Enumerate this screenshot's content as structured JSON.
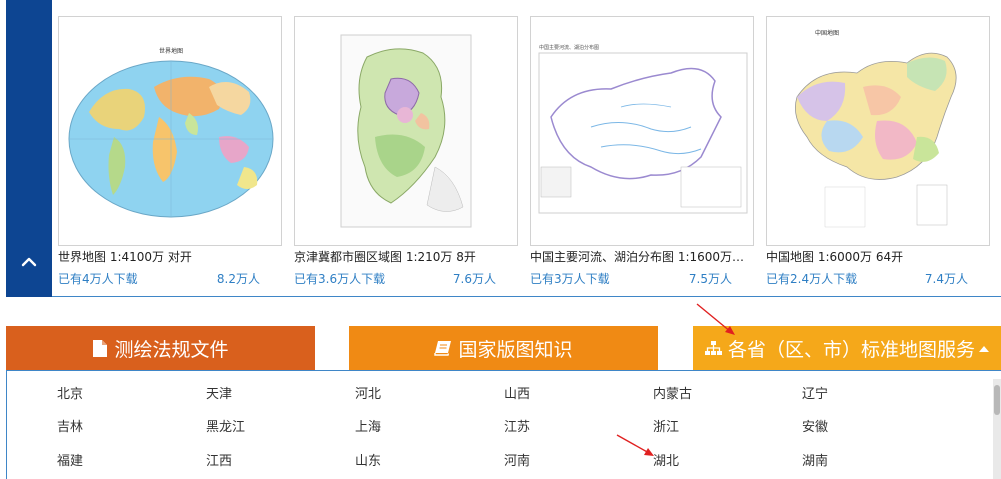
{
  "maps": [
    {
      "title": "世界地图 1:4100万 对开",
      "downloads": "已有4万人下载",
      "views": "8.2万人",
      "thumb_title": "世界地图"
    },
    {
      "title": "京津冀都市圈区域图 1:210万 8开",
      "downloads": "已有3.6万人下载",
      "views": "7.6万人",
      "thumb_title": ""
    },
    {
      "title": "中国主要河流、湖泊分布图 1:1600万…",
      "downloads": "已有3万人下载",
      "views": "7.5万人",
      "thumb_title": "中国主要河流、湖泊分布图"
    },
    {
      "title": "中国地图 1:6000万 64开",
      "downloads": "已有2.4万人下载",
      "views": "7.4万人",
      "thumb_title": "中国地图"
    }
  ],
  "tabs": {
    "laws": "测绘法规文件",
    "knowledge": "国家版图知识",
    "provinces": "各省（区、市）标准地图服务"
  },
  "provinces": [
    "北京",
    "天津",
    "河北",
    "山西",
    "内蒙古",
    "辽宁",
    "吉林",
    "黑龙江",
    "上海",
    "江苏",
    "浙江",
    "安徽",
    "福建",
    "江西",
    "山东",
    "河南",
    "湖北",
    "湖南"
  ],
  "colors": {
    "side_strip": "#0d4592",
    "link_blue": "#2f7fc4",
    "tab_laws": "#d9601d",
    "tab_knowledge": "#f08a14",
    "tab_provinces": "#f5a81a",
    "annotation_arrow": "#e02020"
  },
  "icons": {
    "collapse": "chevron-up-icon",
    "laws": "document-icon",
    "knowledge": "book-icon",
    "provinces": "sitemap-icon",
    "caret": "caret-up-icon"
  }
}
